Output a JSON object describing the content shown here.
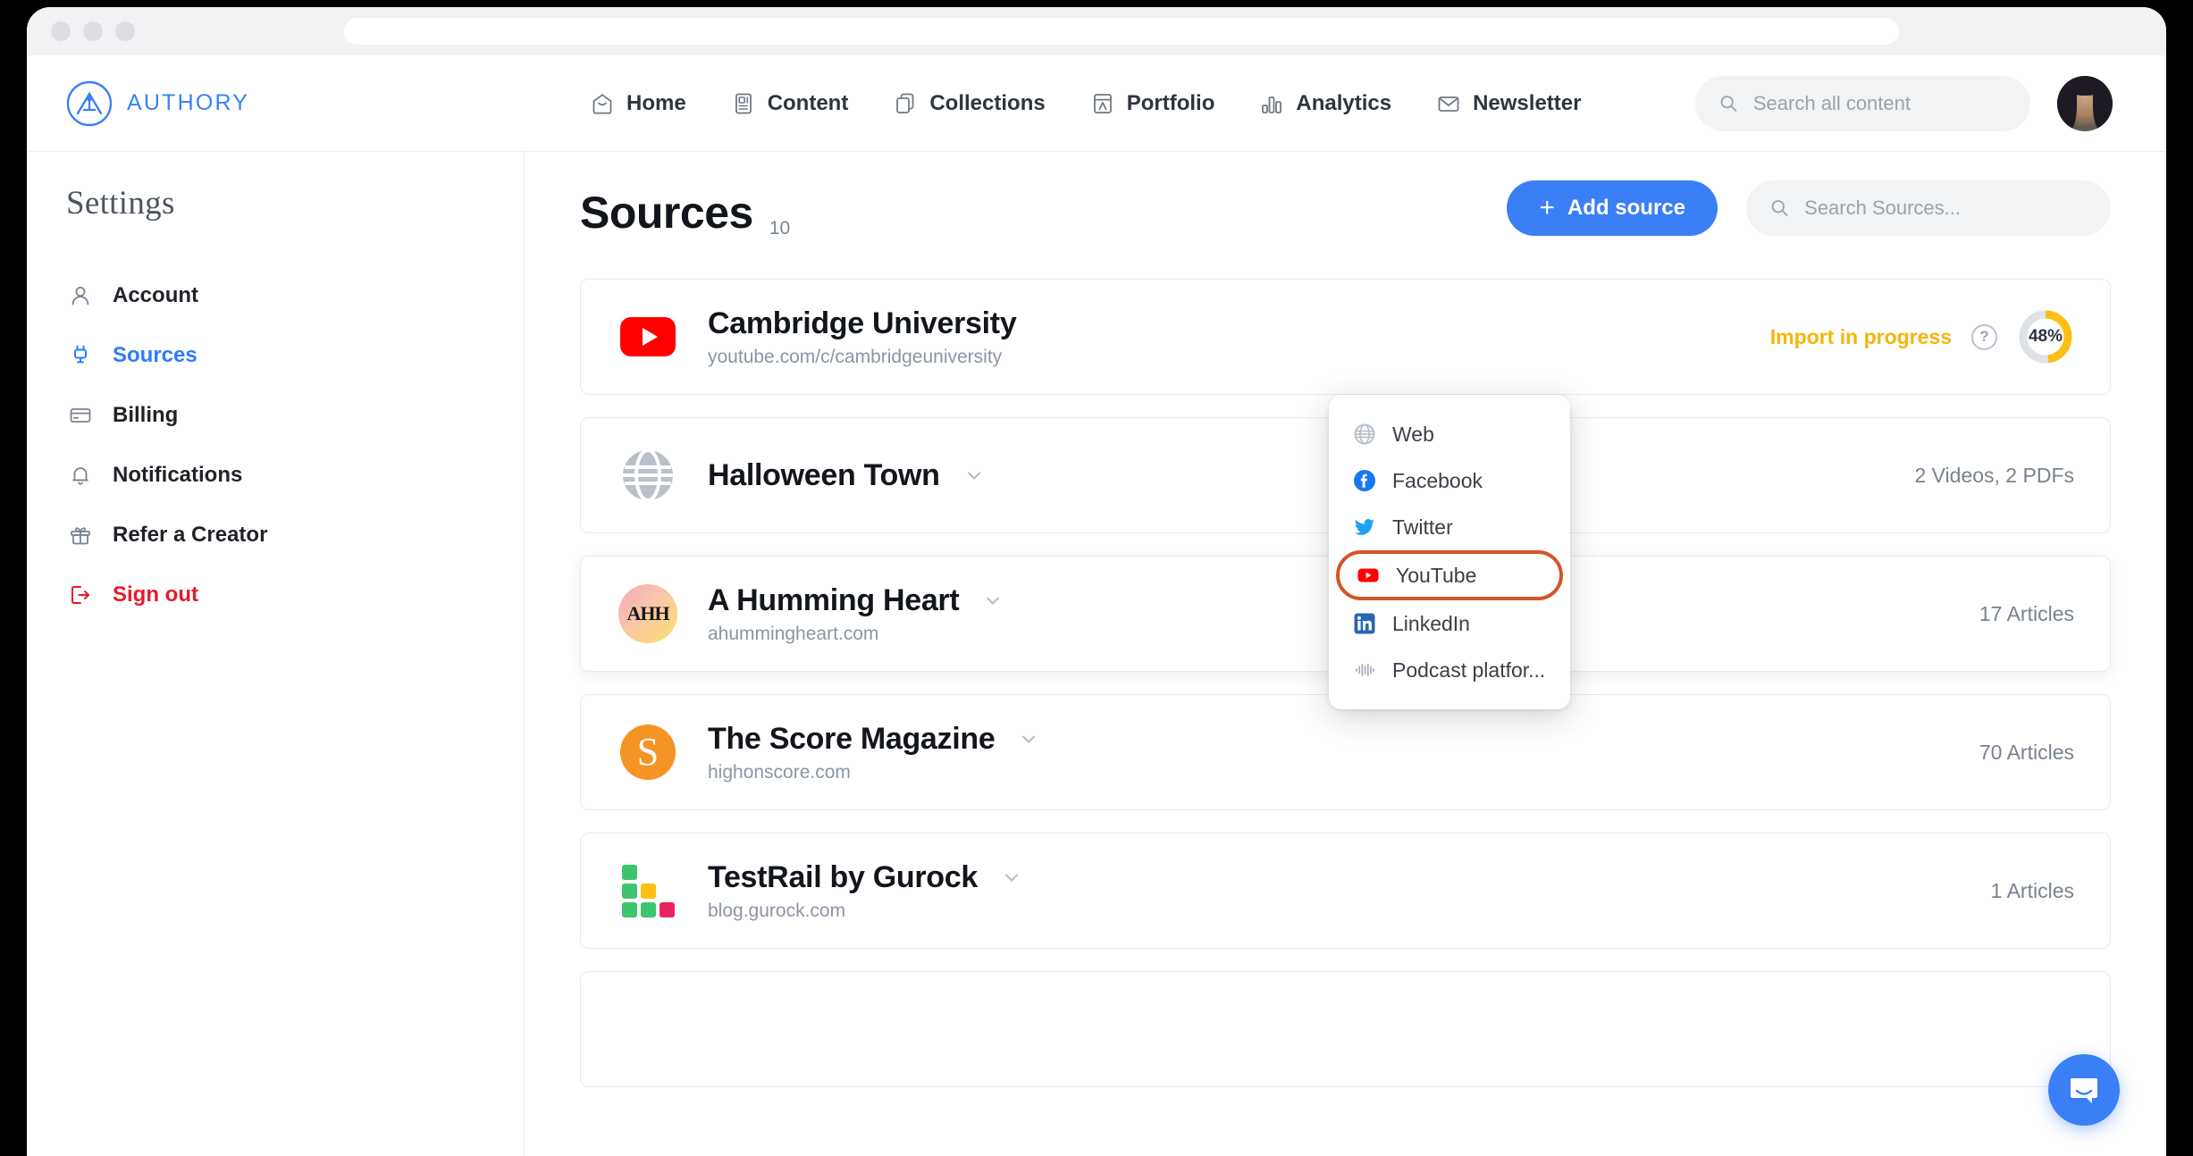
{
  "browser": {
    "traffic_lights": [
      "close",
      "minimize",
      "maximize"
    ],
    "url_value": "",
    "url_placeholder": ""
  },
  "topnav": {
    "brand": "AUTHORY",
    "links": [
      {
        "label": "Home",
        "icon": "home-icon"
      },
      {
        "label": "Content",
        "icon": "content-icon"
      },
      {
        "label": "Collections",
        "icon": "collections-icon"
      },
      {
        "label": "Portfolio",
        "icon": "portfolio-icon"
      },
      {
        "label": "Analytics",
        "icon": "analytics-icon"
      },
      {
        "label": "Newsletter",
        "icon": "newsletter-icon"
      }
    ],
    "search": {
      "value": "",
      "placeholder": "Search all content"
    },
    "avatar_label": "user-avatar"
  },
  "sidebar": {
    "title": "Settings",
    "items": [
      {
        "label": "Account",
        "icon": "person-icon",
        "state": "default"
      },
      {
        "label": "Sources",
        "icon": "plug-icon",
        "state": "active"
      },
      {
        "label": "Billing",
        "icon": "credit-card-icon",
        "state": "default"
      },
      {
        "label": "Notifications",
        "icon": "bell-icon",
        "state": "default"
      },
      {
        "label": "Refer a Creator",
        "icon": "gift-icon",
        "state": "default"
      },
      {
        "label": "Sign out",
        "icon": "logout-icon",
        "state": "danger"
      }
    ]
  },
  "page": {
    "title": "Sources",
    "count": "10",
    "add_button": "Add source",
    "add_button_plus": "+",
    "search": {
      "value": "",
      "placeholder": "Search Sources..."
    }
  },
  "dropdown": {
    "open": true,
    "highlight_color": "#d6532b",
    "items": [
      {
        "label": "Web",
        "icon": "globe-icon",
        "highlighted": false
      },
      {
        "label": "Facebook",
        "icon": "facebook-icon",
        "highlighted": false
      },
      {
        "label": "Twitter",
        "icon": "twitter-icon",
        "highlighted": false
      },
      {
        "label": "YouTube",
        "icon": "youtube-icon",
        "highlighted": true
      },
      {
        "label": "LinkedIn",
        "icon": "linkedin-icon",
        "highlighted": false
      },
      {
        "label": "Podcast platfor...",
        "icon": "podcast-icon",
        "highlighted": false
      }
    ]
  },
  "sources": [
    {
      "name": "Cambridge University",
      "url": "youtube.com/c/cambridgeuniversity",
      "logo": "youtube-logo",
      "has_chevron": false,
      "status": "Import in progress",
      "status_color": "#f5b50a",
      "progress_label": "48%",
      "progress_value": 48,
      "count": ""
    },
    {
      "name": "Halloween Town",
      "url": "",
      "logo": "globe-logo",
      "has_chevron": true,
      "status": "",
      "count": "2 Videos, 2 PDFs"
    },
    {
      "name": "A Humming Heart",
      "url": "ahummingheart.com",
      "logo": "ahh-logo",
      "logo_text": "AHH",
      "has_chevron": true,
      "status": "",
      "count": "17 Articles"
    },
    {
      "name": "The Score Magazine",
      "url": "highonscore.com",
      "logo": "score-logo",
      "logo_text": "S",
      "has_chevron": true,
      "status": "",
      "count": "70 Articles"
    },
    {
      "name": "TestRail by Gurock",
      "url": "blog.gurock.com",
      "logo": "testrail-logo",
      "has_chevron": true,
      "status": "",
      "count": "1 Articles"
    }
  ],
  "testrail_logo_cells": [
    "#3ec46d",
    "",
    "",
    "#3ec46d",
    "#fcc015",
    "",
    "#3ec46d",
    "#3ec46d",
    "#ec2160"
  ],
  "intercom": {
    "label": "messenger-launcher"
  },
  "colors": {
    "brand_blue": "#3b7ff6",
    "accent_blue": "#2f7cf6",
    "danger_red": "#e8192c",
    "warning_yellow": "#f5b50a",
    "highlight_orange": "#d6532b",
    "youtube_red": "#ff0000"
  }
}
